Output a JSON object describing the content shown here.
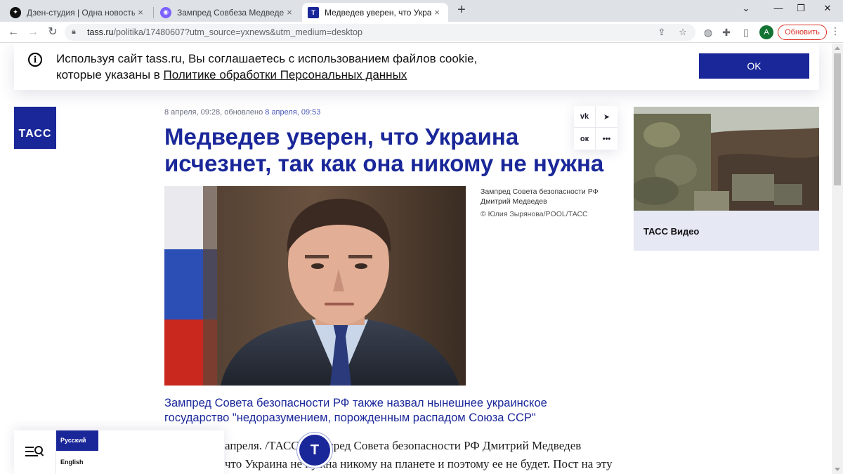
{
  "browser": {
    "tabs": [
      {
        "title": "Дзен-студия | Одна новость и к…",
        "icon": "dzen-icon",
        "active": false
      },
      {
        "title": "Зампред Совбеза Медведев зая…",
        "icon": "yandex-news-icon",
        "active": false
      },
      {
        "title": "Медведев уверен, что Украина…",
        "icon": "tass-icon",
        "active": true
      }
    ],
    "favicon_letter_tass": "T",
    "close_glyph": "×",
    "new_tab_glyph": "+",
    "window_controls": {
      "chevron": "⌄",
      "minimize": "—",
      "restore": "❐",
      "close": "✕"
    },
    "url_host": "tass.ru",
    "url_rest": "/politika/17480607?utm_source=yxnews&utm_medium=desktop",
    "profile_letter": "A",
    "update_label": "Обновить",
    "menu_glyph": "⋮"
  },
  "cookie_banner": {
    "text_before": "Используя сайт tass.ru, Вы соглашаетесь с использованием файлов cookie, которые указаны в ",
    "link_text": "Политике обработки Персональных данных",
    "ok_label": "OK"
  },
  "logo": {
    "text": "ТАСС"
  },
  "article": {
    "published": "8 апреля, 09:28,",
    "updated_label": "обновлено",
    "updated_date": "8 апреля, 09:53",
    "title": "Медведев уверен, что Украина исчезнет, так как она никому не нужна",
    "photo_caption": "Зампред Совета безопасности РФ Дмитрий Медведев",
    "photo_credit": "© Юлия Зырянова/POOL/ТАСС",
    "lead": "Зампред Совета безопасности РФ также назвал нынешнее украинское государство \"недоразумением, порожденным распадом Союза ССР\"",
    "body_line1": "апреля. /ТАСС/. Зампред Совета безопасности РФ Дмитрий Медведев",
    "body_line2": "что Украина не нужна никому на планете и поэтому ее не будет. Пост на эту"
  },
  "share": {
    "vk": "vk",
    "telegram": "➤",
    "ok": "ок",
    "more": "•••"
  },
  "sidebar": {
    "video_label": "ТАСС Видео"
  },
  "language_panel": {
    "russian": "Русский",
    "english": "English"
  },
  "fab": {
    "letter": "T"
  },
  "colors": {
    "brand": "#1a2799",
    "update_red": "#d93025"
  }
}
